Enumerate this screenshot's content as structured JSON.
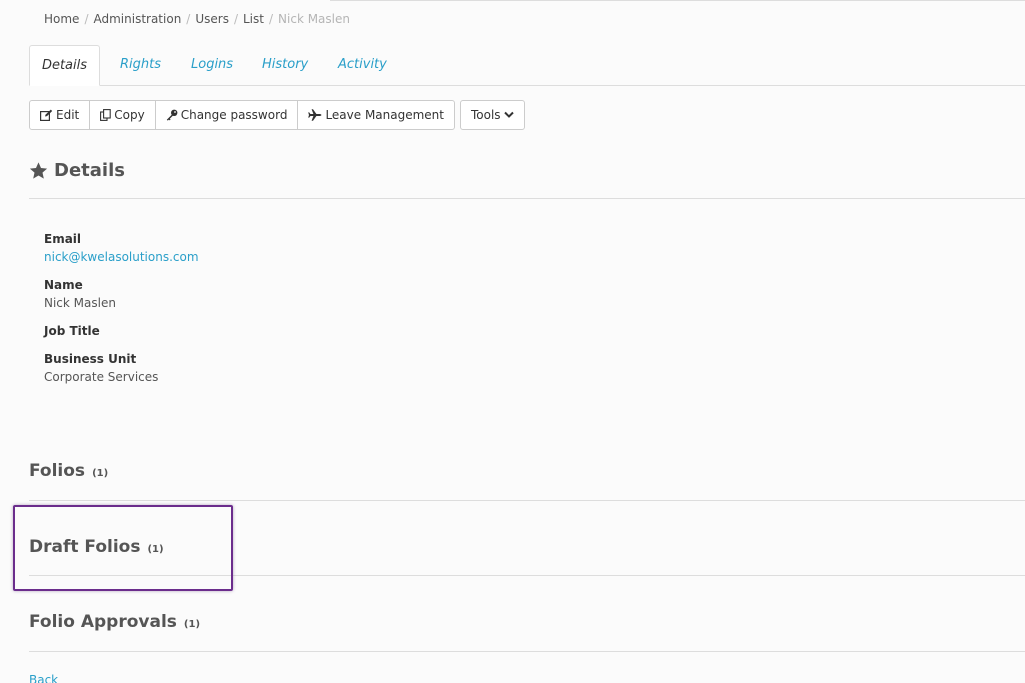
{
  "breadcrumb": {
    "items": [
      "Home",
      "Administration",
      "Users",
      "List"
    ],
    "current": "Nick Maslen",
    "separator": "/"
  },
  "tabs": [
    {
      "label": "Details",
      "active": true
    },
    {
      "label": "Rights",
      "active": false
    },
    {
      "label": "Logins",
      "active": false
    },
    {
      "label": "History",
      "active": false
    },
    {
      "label": "Activity",
      "active": false
    }
  ],
  "toolbar": {
    "edit_label": "Edit",
    "copy_label": "Copy",
    "change_password_label": "Change password",
    "leave_management_label": "Leave Management",
    "tools_label": "Tools"
  },
  "details": {
    "title": "Details",
    "email_label": "Email",
    "email_value": "nick@kwelasolutions.com",
    "name_label": "Name",
    "name_value": "Nick Maslen",
    "job_title_label": "Job Title",
    "business_unit_label": "Business Unit",
    "business_unit_value": "Corporate Services"
  },
  "sections": {
    "folios": {
      "title": "Folios",
      "count": "(1)"
    },
    "draft_folios": {
      "title": "Draft Folios",
      "count": "(1)"
    },
    "folio_approvals": {
      "title": "Folio Approvals",
      "count": "(1)"
    }
  },
  "footer": {
    "back_label": "Back"
  },
  "colors": {
    "link": "#2a9fc9",
    "highlight": "#6b2d8c",
    "border": "#dddddd"
  },
  "icons": {
    "edit": "edit-icon",
    "copy": "copy-icon",
    "key": "key-icon",
    "plane": "plane-icon",
    "chevron": "chevron-down-icon",
    "star": "star-icon"
  }
}
